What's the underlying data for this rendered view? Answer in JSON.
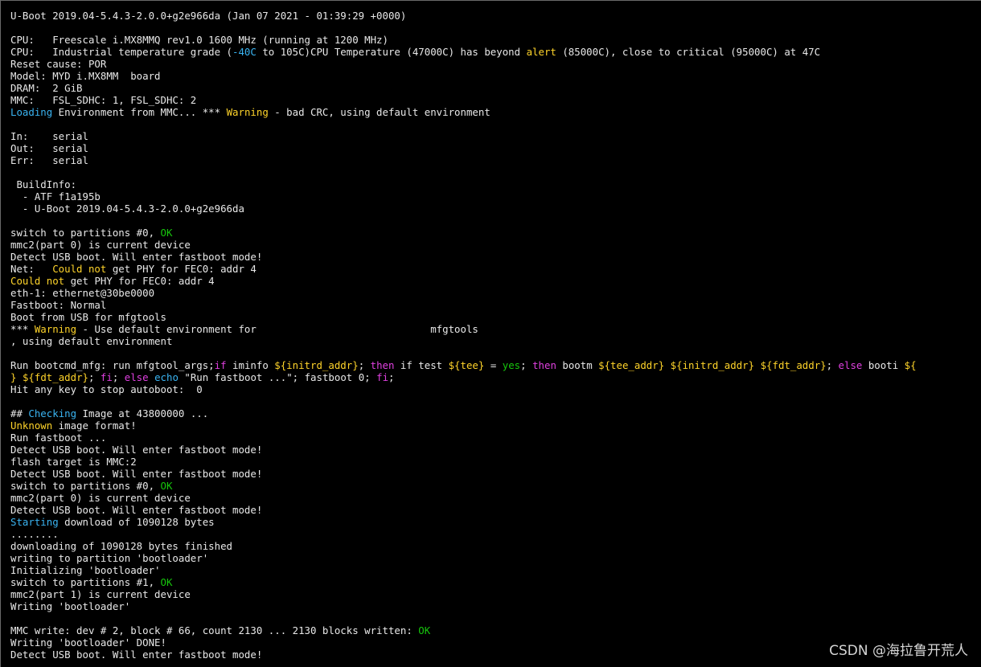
{
  "colors": {
    "background": "#000000",
    "default": "#e8e8e8",
    "yellow": "#ffd42a",
    "cyan": "#3ab4f2",
    "green": "#16c60c",
    "magenta": "#e040e0"
  },
  "terminal": {
    "lines": [
      [
        {
          "t": "U-Boot 2019.04-5.4.3-2.0.0+g2e966da (Jan 07 2021 - 01:39:29 +0000)"
        }
      ],
      [],
      [
        {
          "t": "CPU:   Freescale i.MX8MMQ rev1.0 1600 MHz (running at 1200 MHz)"
        }
      ],
      [
        {
          "t": "CPU:   Industrial temperature grade ("
        },
        {
          "t": "-40C",
          "c": "cyan"
        },
        {
          "t": " to 105C)CPU Temperature (47000C) has beyond "
        },
        {
          "t": "alert",
          "c": "yellow"
        },
        {
          "t": " (85000C), close to critical (95000C) at 47C"
        }
      ],
      [
        {
          "t": "Reset cause: POR"
        }
      ],
      [
        {
          "t": "Model: MYD i.MX8MM  board"
        }
      ],
      [
        {
          "t": "DRAM:  2 GiB"
        }
      ],
      [
        {
          "t": "MMC:   FSL_SDHC: 1, FSL_SDHC: 2"
        }
      ],
      [
        {
          "t": "Loading",
          "c": "cyan"
        },
        {
          "t": " Environment from MMC... *** "
        },
        {
          "t": "Warning",
          "c": "yellow"
        },
        {
          "t": " - bad CRC, using default environment"
        }
      ],
      [],
      [
        {
          "t": "In:    serial"
        }
      ],
      [
        {
          "t": "Out:   serial"
        }
      ],
      [
        {
          "t": "Err:   serial"
        }
      ],
      [],
      [
        {
          "t": " BuildInfo:"
        }
      ],
      [
        {
          "t": "  - ATF f1a195b"
        }
      ],
      [
        {
          "t": "  - U-Boot 2019.04-5.4.3-2.0.0+g2e966da"
        }
      ],
      [],
      [
        {
          "t": "switch to partitions #0, "
        },
        {
          "t": "OK",
          "c": "green"
        }
      ],
      [
        {
          "t": "mmc2(part 0) is current device"
        }
      ],
      [
        {
          "t": "Detect USB boot. Will enter fastboot mode!"
        }
      ],
      [
        {
          "t": "Net:   "
        },
        {
          "t": "Could not",
          "c": "yellow"
        },
        {
          "t": " get PHY for FEC0: addr 4"
        }
      ],
      [
        {
          "t": "Could not",
          "c": "yellow"
        },
        {
          "t": " get PHY for FEC0: addr 4"
        }
      ],
      [
        {
          "t": "eth-1: ethernet@30be0000"
        }
      ],
      [
        {
          "t": "Fastboot: Normal"
        }
      ],
      [
        {
          "t": "Boot from USB for mfgtools"
        }
      ],
      [
        {
          "t": "*** "
        },
        {
          "t": "Warning",
          "c": "yellow"
        },
        {
          "t": " - Use default environment for                             mfgtools"
        }
      ],
      [
        {
          "t": ", using default environment"
        }
      ],
      [],
      [
        {
          "t": "Run bootcmd_mfg: run mfgtool_args;"
        },
        {
          "t": "if",
          "c": "magenta"
        },
        {
          "t": " iminfo "
        },
        {
          "t": "${initrd_addr}",
          "c": "yellow"
        },
        {
          "t": "; "
        },
        {
          "t": "then",
          "c": "magenta"
        },
        {
          "t": " if test "
        },
        {
          "t": "${tee}",
          "c": "yellow"
        },
        {
          "t": " = "
        },
        {
          "t": "yes",
          "c": "green"
        },
        {
          "t": "; "
        },
        {
          "t": "then",
          "c": "magenta"
        },
        {
          "t": " bootm "
        },
        {
          "t": "${tee_addr}",
          "c": "yellow"
        },
        {
          "t": " "
        },
        {
          "t": "${initrd_addr}",
          "c": "yellow"
        },
        {
          "t": " "
        },
        {
          "t": "${fdt_addr}",
          "c": "yellow"
        },
        {
          "t": "; "
        },
        {
          "t": "else",
          "c": "magenta"
        },
        {
          "t": " booti "
        },
        {
          "t": "${",
          "c": "yellow"
        }
      ],
      [
        {
          "t": "}",
          "c": "yellow"
        },
        {
          "t": " "
        },
        {
          "t": "${fdt_addr}",
          "c": "yellow"
        },
        {
          "t": "; "
        },
        {
          "t": "fi",
          "c": "magenta"
        },
        {
          "t": "; "
        },
        {
          "t": "else",
          "c": "magenta"
        },
        {
          "t": " "
        },
        {
          "t": "echo",
          "c": "cyan"
        },
        {
          "t": " \"Run fastboot ...\"; fastboot 0; "
        },
        {
          "t": "fi",
          "c": "magenta"
        },
        {
          "t": ";"
        }
      ],
      [
        {
          "t": "Hit any key to stop autoboot:  0"
        }
      ],
      [],
      [
        {
          "t": "## "
        },
        {
          "t": "Checking",
          "c": "cyan"
        },
        {
          "t": " Image at 43800000 ..."
        }
      ],
      [
        {
          "t": "Unknown",
          "c": "yellow"
        },
        {
          "t": " image format!"
        }
      ],
      [
        {
          "t": "Run fastboot ..."
        }
      ],
      [
        {
          "t": "Detect USB boot. Will enter fastboot mode!"
        }
      ],
      [
        {
          "t": "flash target is MMC:2"
        }
      ],
      [
        {
          "t": "Detect USB boot. Will enter fastboot mode!"
        }
      ],
      [
        {
          "t": "switch to partitions #0, "
        },
        {
          "t": "OK",
          "c": "green"
        }
      ],
      [
        {
          "t": "mmc2(part 0) is current device"
        }
      ],
      [
        {
          "t": "Detect USB boot. Will enter fastboot mode!"
        }
      ],
      [
        {
          "t": "Starting",
          "c": "cyan"
        },
        {
          "t": " download of 1090128 bytes"
        }
      ],
      [
        {
          "t": "........"
        }
      ],
      [
        {
          "t": "downloading of 1090128 bytes finished"
        }
      ],
      [
        {
          "t": "writing to partition 'bootloader'"
        }
      ],
      [
        {
          "t": "Initializing 'bootloader'"
        }
      ],
      [
        {
          "t": "switch to partitions #1, "
        },
        {
          "t": "OK",
          "c": "green"
        }
      ],
      [
        {
          "t": "mmc2(part 1) is current device"
        }
      ],
      [
        {
          "t": "Writing 'bootloader'"
        }
      ],
      [],
      [
        {
          "t": "MMC write: dev # 2, block # 66, count 2130 ... 2130 blocks written: "
        },
        {
          "t": "OK",
          "c": "green"
        }
      ],
      [
        {
          "t": "Writing 'bootloader' DONE!"
        }
      ],
      [
        {
          "t": "Detect USB boot. Will enter fastboot mode!"
        }
      ]
    ]
  },
  "watermark": "CSDN @海拉鲁开荒人"
}
